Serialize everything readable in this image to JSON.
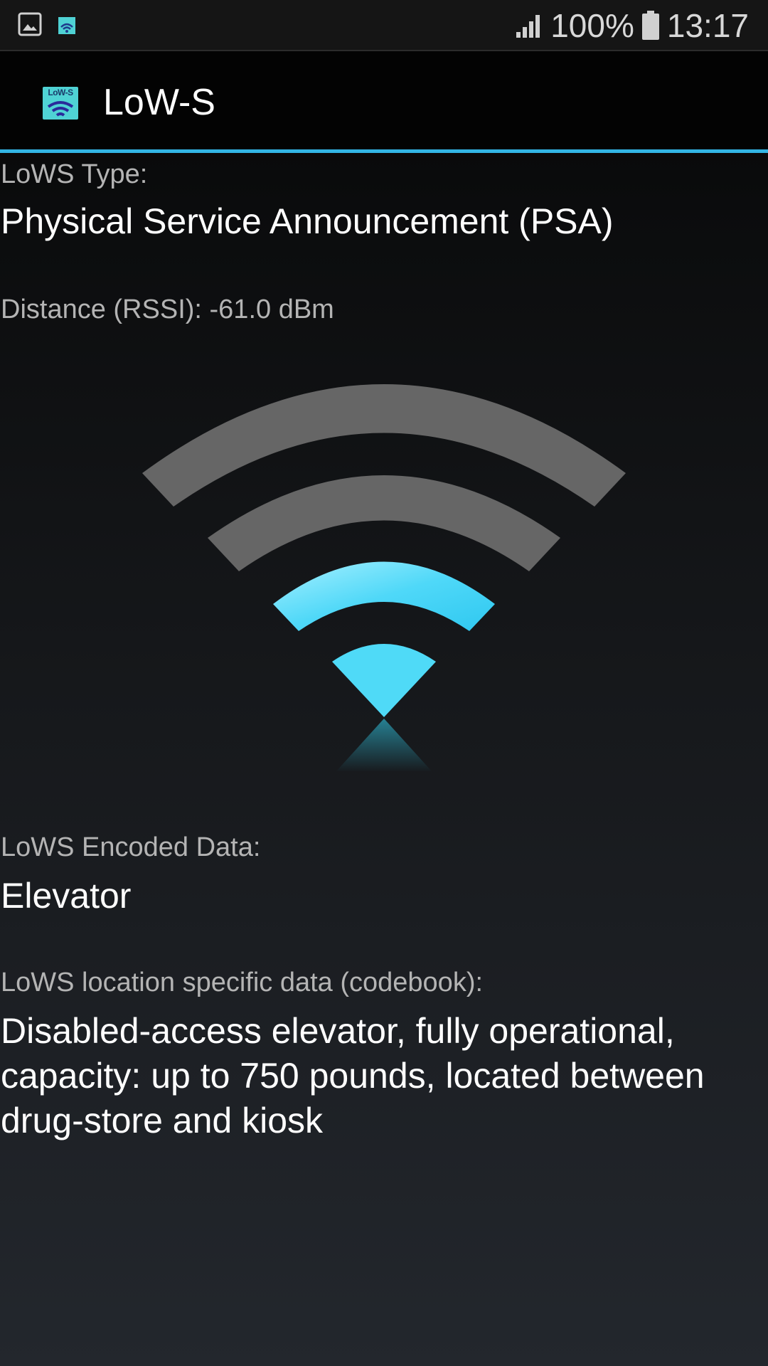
{
  "status_bar": {
    "left_icons": [
      "gallery-notification-icon",
      "lows-app-notification-icon"
    ],
    "battery_percent": "100%",
    "time": "13:17",
    "signal_icon": "cell-signal-icon",
    "battery_icon": "battery-icon"
  },
  "action_bar": {
    "logo_text": "LoW-S",
    "title": "LoW-S",
    "accent_color": "#33b5e5"
  },
  "content": {
    "type_label": "LoWS Type:",
    "type_value": "Physical Service Announcement (PSA)",
    "distance_text": "Distance (RSSI): -61.0 dBm",
    "signal_graphic": {
      "icon": "wifi-signal-strength-icon",
      "active_color": "#33d6f5",
      "inactive_color": "#666666",
      "active_bars": 2,
      "total_bars": 4
    },
    "encoded_label": "LoWS Encoded Data:",
    "encoded_value": "Elevator",
    "codebook_label": "LoWS location specific data (codebook):",
    "codebook_value": "Disabled-access elevator, fully operational, capacity: up to 750 pounds, located between drug-store and kiosk"
  }
}
